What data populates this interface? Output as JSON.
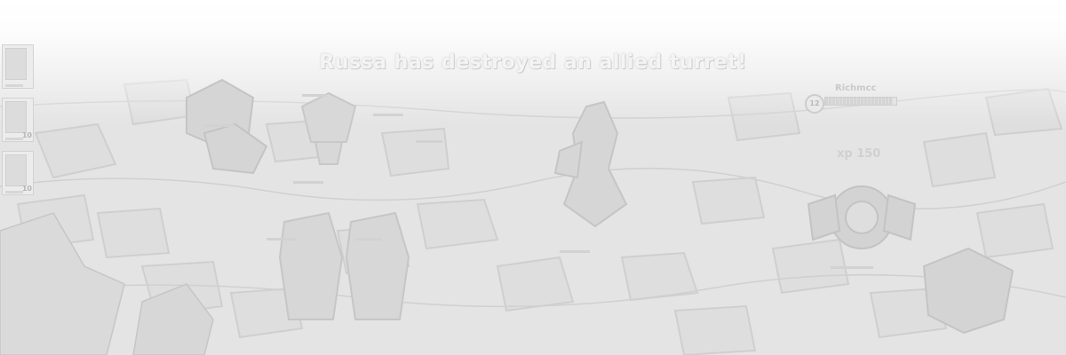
{
  "game": {
    "announcement": "Russa has destroyed an allied turret!",
    "card_counts": [
      "",
      "10",
      "10"
    ],
    "enemy_champion": {
      "name": "Richmcc",
      "level": "12",
      "health_fraction": 0.95
    },
    "damage_text": "xp 150"
  },
  "colors": {
    "floor": "#e6e6e6",
    "stone": "#dcdcdc",
    "grout": "#cfcfcf",
    "unit": "#d6d6d6"
  },
  "icons": [
    "card-minion-icon",
    "card-archer-icon",
    "card-golem-icon",
    "level-badge-icon"
  ]
}
